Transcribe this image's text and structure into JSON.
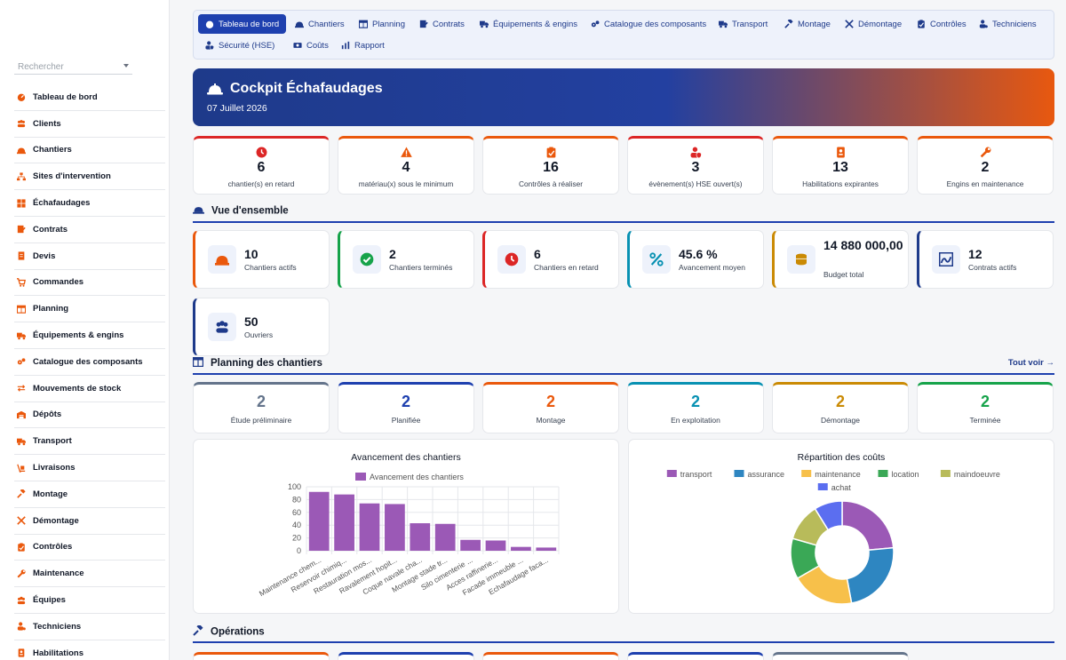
{
  "sidebar": {
    "search_placeholder": "Rechercher",
    "items": [
      {
        "label": "Tableau de bord",
        "icon": "gauge-icon"
      },
      {
        "label": "Clients",
        "icon": "users-icon"
      },
      {
        "label": "Chantiers",
        "icon": "hardhat-icon"
      },
      {
        "label": "Sites d'intervention",
        "icon": "sitemap-icon"
      },
      {
        "label": "Échafaudages",
        "icon": "grid-icon"
      },
      {
        "label": "Contrats",
        "icon": "contract-icon"
      },
      {
        "label": "Devis",
        "icon": "invoice-icon"
      },
      {
        "label": "Commandes",
        "icon": "cart-icon"
      },
      {
        "label": "Planning",
        "icon": "calendar-icon"
      },
      {
        "label": "Équipements & engins",
        "icon": "truck-icon"
      },
      {
        "label": "Catalogue des composants",
        "icon": "cogs-icon"
      },
      {
        "label": "Mouvements de stock",
        "icon": "arrows-icon"
      },
      {
        "label": "Dépôts",
        "icon": "warehouse-icon"
      },
      {
        "label": "Transport",
        "icon": "truck-icon"
      },
      {
        "label": "Livraisons",
        "icon": "dolly-icon"
      },
      {
        "label": "Montage",
        "icon": "hammer-icon"
      },
      {
        "label": "Démontage",
        "icon": "tools-icon"
      },
      {
        "label": "Contrôles",
        "icon": "clipboard-check-icon"
      },
      {
        "label": "Maintenance",
        "icon": "wrench-icon"
      },
      {
        "label": "Équipes",
        "icon": "people-icon"
      },
      {
        "label": "Techniciens",
        "icon": "user-gear-icon"
      },
      {
        "label": "Habilitations",
        "icon": "badge-icon"
      }
    ]
  },
  "topnav": {
    "tabs": [
      {
        "label": "Tableau de bord",
        "active": true
      },
      {
        "label": "Chantiers"
      },
      {
        "label": "Planning"
      },
      {
        "label": "Contrats"
      },
      {
        "label": "Équipements & engins"
      },
      {
        "label": "Catalogue des composants"
      },
      {
        "label": "Transport"
      },
      {
        "label": "Montage"
      },
      {
        "label": "Démontage"
      },
      {
        "label": "Contrôles"
      },
      {
        "label": "Techniciens"
      },
      {
        "label": "Sécurité (HSE)"
      },
      {
        "label": "Coûts"
      },
      {
        "label": "Rapport"
      }
    ]
  },
  "hero": {
    "title": "Cockpit Échafaudages",
    "date": "07 Juillet 2026"
  },
  "alerts": [
    {
      "value": "6",
      "label": "chantier(s) en retard",
      "color": "#dc2626",
      "icon": "clock-icon"
    },
    {
      "value": "4",
      "label": "matériau(x) sous le minimum",
      "color": "#ea580c",
      "icon": "warning-icon"
    },
    {
      "value": "16",
      "label": "Contrôles à réaliser",
      "color": "#ea580c",
      "icon": "clipboard-check-icon"
    },
    {
      "value": "3",
      "label": "évènement(s) HSE ouvert(s)",
      "color": "#dc2626",
      "icon": "user-shield-icon"
    },
    {
      "value": "13",
      "label": "Habilitations expirantes",
      "color": "#ea580c",
      "icon": "badge-icon"
    },
    {
      "value": "2",
      "label": "Engins en maintenance",
      "color": "#ea580c",
      "icon": "wrench-icon"
    }
  ],
  "overview": {
    "title": "Vue d'ensemble",
    "stats": [
      {
        "value": "10",
        "label": "Chantiers actifs",
        "color": "#ea580c",
        "icon": "hardhat-icon"
      },
      {
        "value": "2",
        "label": "Chantiers terminés",
        "color": "#16a34a",
        "icon": "check-circle-icon"
      },
      {
        "value": "6",
        "label": "Chantiers en retard",
        "color": "#dc2626",
        "icon": "clock-icon"
      },
      {
        "value": "45.6 %",
        "label": "Avancement moyen",
        "color": "#0891b2",
        "icon": "percent-icon"
      },
      {
        "value": "14 880 000,00",
        "label": "Budget total",
        "color": "#ca8a04",
        "icon": "coins-icon"
      },
      {
        "value": "12",
        "label": "Contrats actifs",
        "color": "#1e3a8a",
        "icon": "signature-icon"
      },
      {
        "value": "50",
        "label": "Ouvriers",
        "color": "#1e3a8a",
        "icon": "people-icon"
      }
    ]
  },
  "planning": {
    "title": "Planning des chantiers",
    "link": "Tout voir →",
    "phases": [
      {
        "value": "2",
        "label": "Étude préliminaire",
        "color": "#64748b"
      },
      {
        "value": "2",
        "label": "Planifiée",
        "color": "#1e40af"
      },
      {
        "value": "2",
        "label": "Montage",
        "color": "#ea580c"
      },
      {
        "value": "2",
        "label": "En exploitation",
        "color": "#0891b2"
      },
      {
        "value": "2",
        "label": "Démontage",
        "color": "#ca8a04"
      },
      {
        "value": "2",
        "label": "Terminée",
        "color": "#16a34a"
      }
    ]
  },
  "operations": {
    "title": "Opérations"
  },
  "chart_data": [
    {
      "type": "bar",
      "title": "Avancement des chantiers",
      "series": [
        {
          "name": "Avancement des chantiers",
          "values": [
            92,
            88,
            74,
            73,
            43,
            42,
            17,
            16,
            6,
            5
          ]
        }
      ],
      "categories": [
        "Maintenance chem...",
        "Reservoir chimiq...",
        "Restauration mos...",
        "Ravalement hopit...",
        "Coque navale cha...",
        "Montage stade tr...",
        "Silo cimenterie ...",
        "Acces raffinerie...",
        "Facade immeuble ...",
        "Echafaudage faca..."
      ],
      "ylim": [
        0,
        100
      ],
      "yticks": [
        0,
        20,
        40,
        60,
        80,
        100
      ],
      "grid": true,
      "legend": "top",
      "color": "#9b59b6"
    },
    {
      "type": "pie",
      "title": "Répartition des coûts",
      "categories": [
        "transport",
        "assurance",
        "maintenance",
        "location",
        "maindoeuvre",
        "achat"
      ],
      "values": [
        24,
        24,
        20,
        13,
        12,
        9
      ],
      "colors": [
        "#9b59b6",
        "#2e86c1",
        "#f7c04a",
        "#3aa856",
        "#b8bb5a",
        "#5b6ef0"
      ],
      "legend": "top"
    }
  ]
}
